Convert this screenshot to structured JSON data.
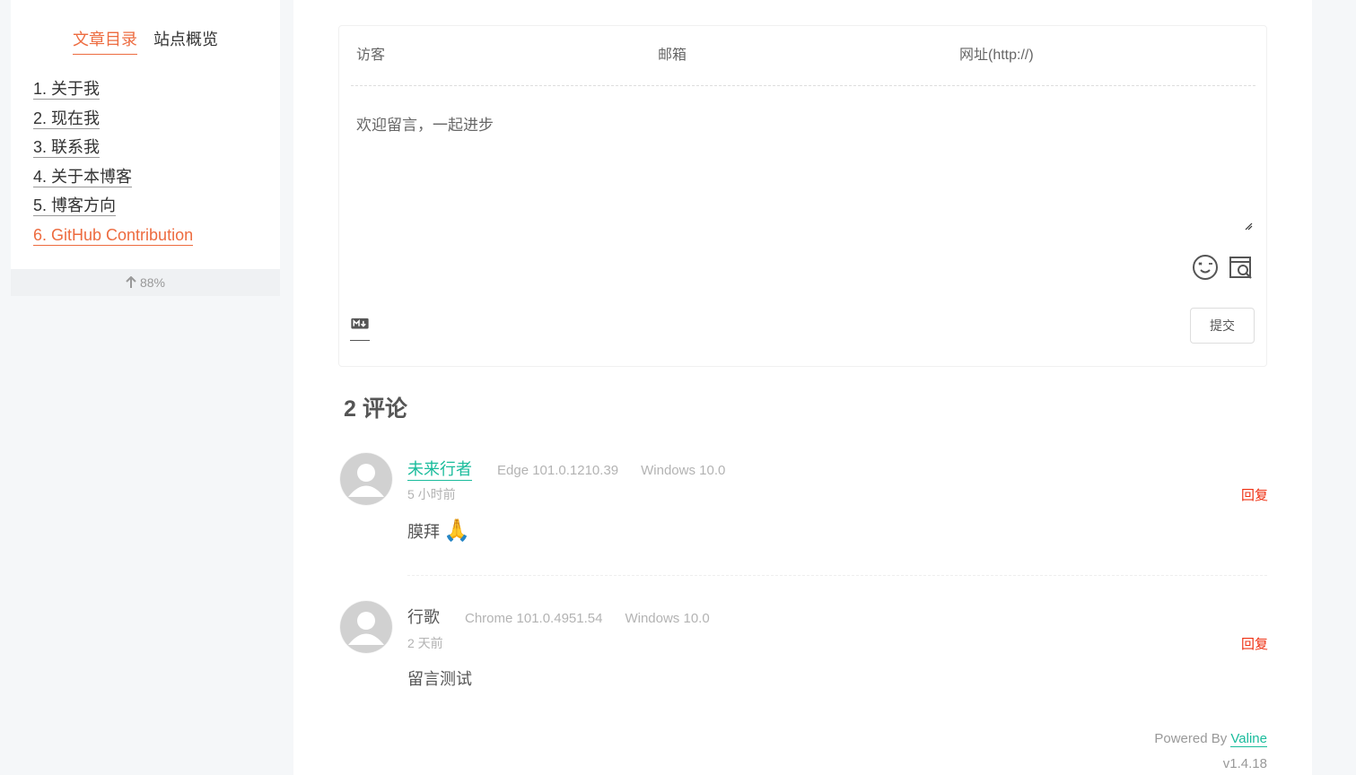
{
  "sidebar": {
    "tabs": [
      {
        "label": "文章目录",
        "active": true
      },
      {
        "label": "站点概览",
        "active": false
      }
    ],
    "toc": [
      {
        "label": "1. 关于我"
      },
      {
        "label": "2. 现在我"
      },
      {
        "label": "3. 联系我"
      },
      {
        "label": "4. 关于本博客"
      },
      {
        "label": "5. 博客方向"
      },
      {
        "label": "6. GitHub Contribution",
        "active": true
      }
    ],
    "progress": "88%"
  },
  "comment_form": {
    "nick_placeholder": "访客",
    "mail_placeholder": "邮箱",
    "link_placeholder": "网址(http://)",
    "text_placeholder": "欢迎留言，一起进步",
    "submit_label": "提交"
  },
  "comments_header": "2 评论",
  "comments": [
    {
      "nick": "未来行者",
      "browser": "Edge 101.0.1210.39",
      "os": "Windows 10.0",
      "time": "5 小时前",
      "reply": "回复",
      "text": "膜拜",
      "emoji": "🙏"
    },
    {
      "nick": "行歌",
      "browser": "Chrome 101.0.4951.54",
      "os": "Windows 10.0",
      "time": "2 天前",
      "reply": "回复",
      "text": "留言测试"
    }
  ],
  "footer": {
    "powered_by": "Powered By",
    "brand": "Valine",
    "version": "v1.4.18"
  },
  "colors": {
    "accent": "#ed6b3f",
    "link": "#1abc9c",
    "reply": "#ef2f11"
  }
}
